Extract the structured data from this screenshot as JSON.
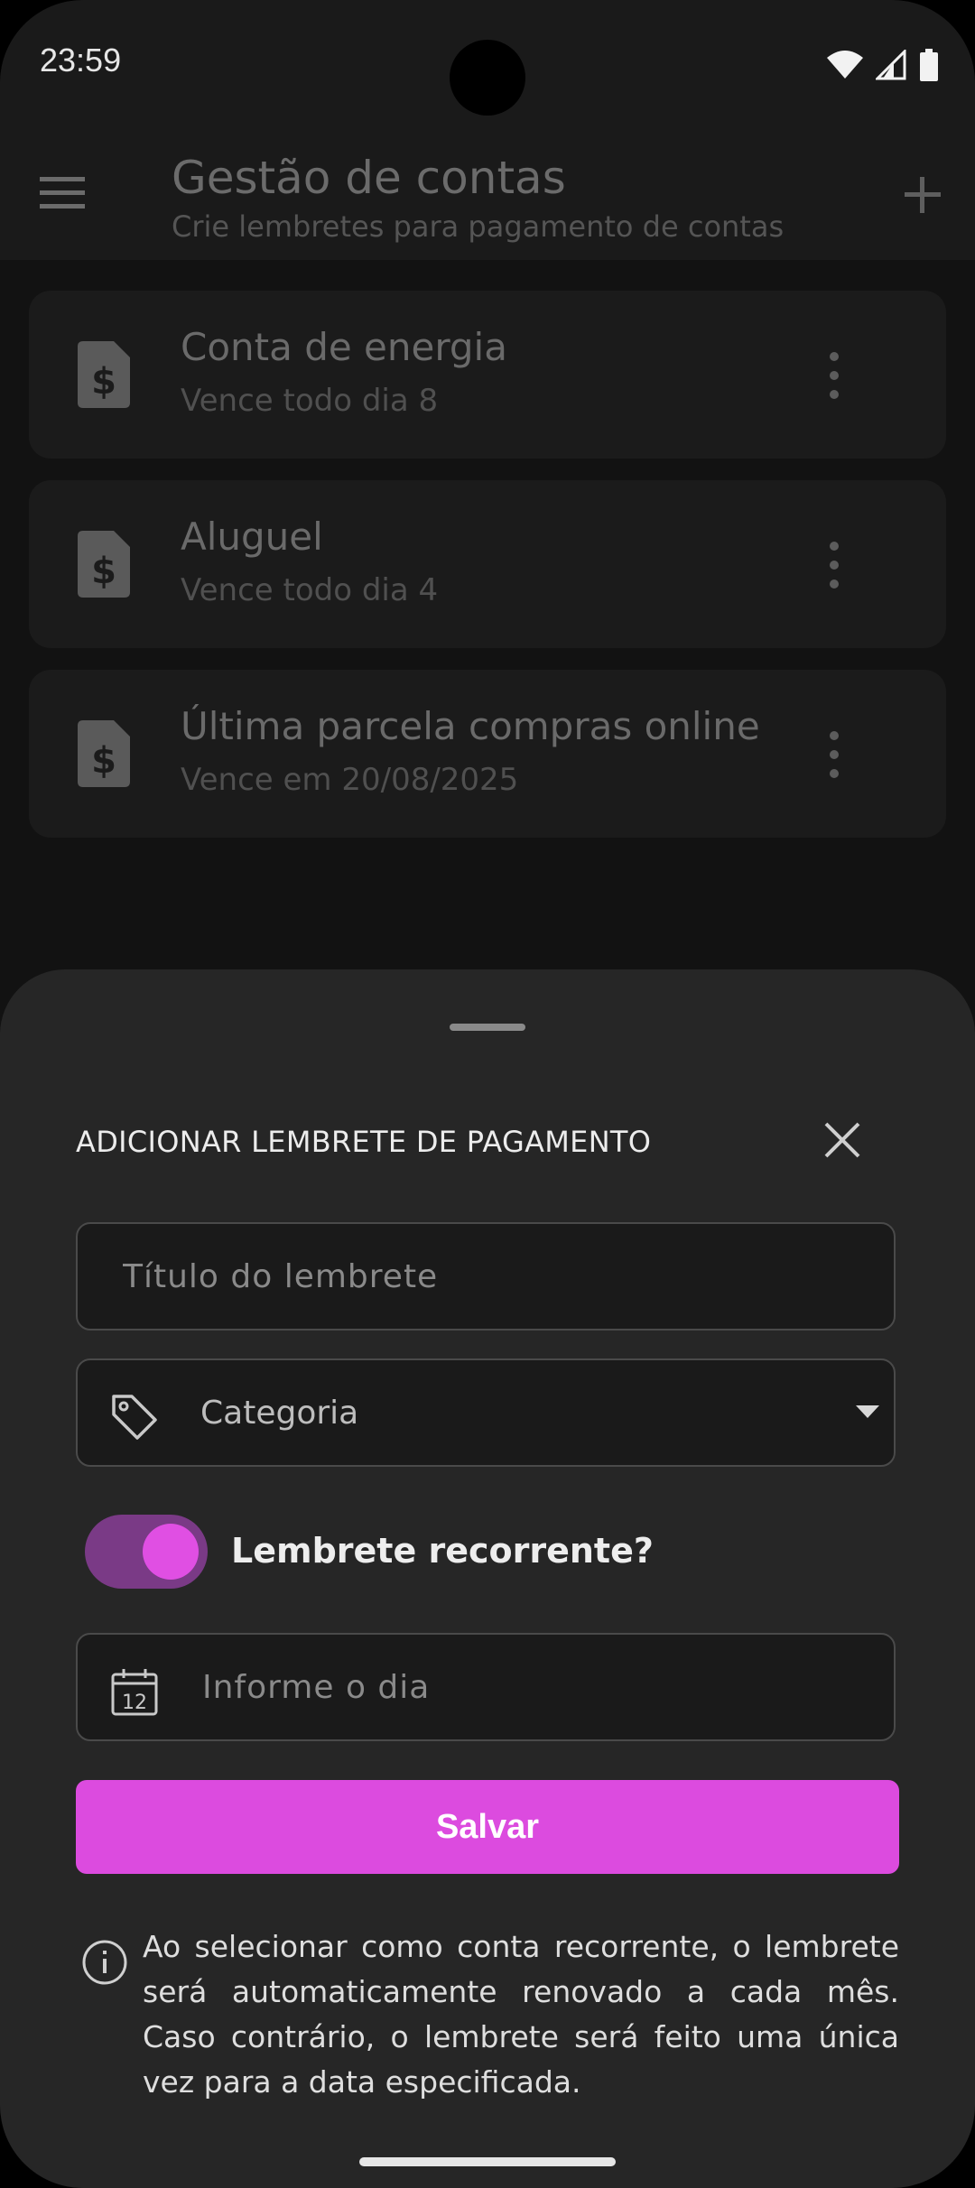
{
  "status_bar": {
    "time": "23:59"
  },
  "app_bar": {
    "title": "Gestão de contas",
    "subtitle": "Crie lembretes para pagamento de contas"
  },
  "bills": [
    {
      "title": "Conta de energia",
      "due": "Vence todo dia 8"
    },
    {
      "title": "Aluguel",
      "due": "Vence todo dia 4"
    },
    {
      "title": "Última parcela compras online",
      "due": "Vence em 20/08/2025"
    }
  ],
  "sheet": {
    "title": "ADICIONAR LEMBRETE DE PAGAMENTO",
    "title_placeholder": "Título do lembrete",
    "category_value": "Categoria",
    "recurring_label": "Lembrete recorrente?",
    "recurring_on": true,
    "day_placeholder": "Informe o dia",
    "calendar_icon_day": "12",
    "save_label": "Salvar",
    "info_text": "Ao selecionar como conta recorrente, o lembrete será automaticamente renovado a cada mês. Caso contrário, o lembrete será feito uma única vez para a data especificada."
  },
  "colors": {
    "accent": "#dc4bdf",
    "toggle_track": "#7a3a86",
    "sheet_bg": "#262626",
    "screen_bg": "#121212"
  }
}
